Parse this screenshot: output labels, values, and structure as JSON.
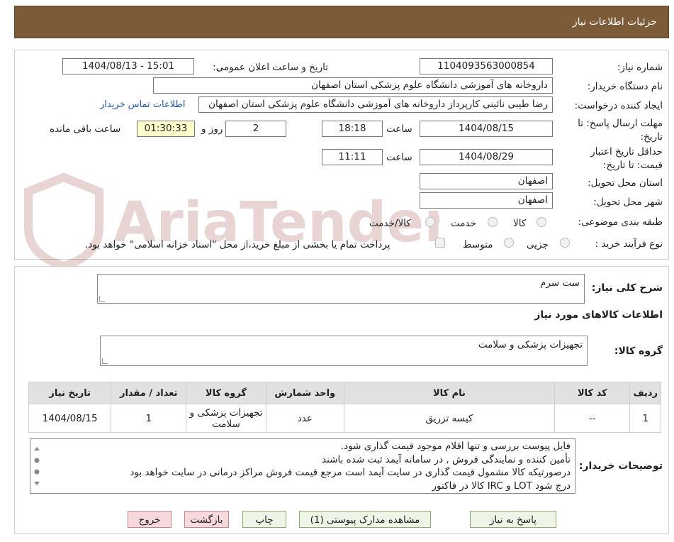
{
  "header": {
    "title": "جزئیات اطلاعات نیاز"
  },
  "form": {
    "need_number_label": "شماره نیاز:",
    "need_number": "1104093563000854",
    "announce_label": "تاریخ و ساعت اعلان عمومی:",
    "announce_value": "1404/08/13 - 15:01",
    "buyer_org_label": "نام دستگاه خریدار:",
    "buyer_org": "داروخانه های آموزشی دانشگاه علوم پزشکی استان اصفهان",
    "requester_label": "ایجاد کننده درخواست:",
    "requester": "رضا طیبی نائینی کارپرداز داروخانه های آموزشی دانشگاه علوم پزشکی استان اصفهان",
    "contact_link": "اطلاعات تماس خریدار",
    "deadline_label": "مهلت ارسال پاسخ: تا تاریخ:",
    "deadline_date": "1404/08/15",
    "time_label": "ساعت",
    "deadline_time": "18:18",
    "days_value": "2",
    "days_label": "روز و",
    "remaining_time": "01:30:33",
    "remaining_label": "ساعت باقی مانده",
    "validity_label": "حداقل تاریخ اعتبار قیمت: تا تاریخ:",
    "validity_date": "1404/08/29",
    "validity_time": "11:11",
    "province_label": "استان محل تحویل:",
    "province": "اصفهان",
    "city_label": "شهر محل تحویل:",
    "city": "اصفهان",
    "category_label": "طبقه بندی موضوعی:",
    "category_options": [
      "کالا",
      "خدمت",
      "کالا/خدمت"
    ],
    "process_label": "نوع فرآیند خرید :",
    "process_options": [
      "جزیی",
      "متوسط"
    ],
    "payment_note": "پرداخت تمام یا بخشی از مبلغ خرید،از محل \"اسناد خزانه اسلامی\" خواهد بود."
  },
  "summary": {
    "label": "شرح کلی نیاز:",
    "value": "ست سرم",
    "items_title": "اطلاعات کالاهای مورد نیاز",
    "group_label": "گروه کالا:",
    "group_value": "تجهیزات پزشکی و سلامت"
  },
  "table": {
    "headers": [
      "ردیف",
      "کد کالا",
      "نام کالا",
      "واحد شمارش",
      "گروه کالا",
      "تعداد / مقدار",
      "تاریخ نیاز"
    ],
    "rows": [
      [
        "1",
        "--",
        "کیسه تزریق",
        "عدد",
        "تجهیزات پزشکی و سلامت",
        "1",
        "1404/08/15"
      ]
    ]
  },
  "notes": {
    "label": "توضیحات خریدار:",
    "lines": [
      "فایل پیوست بررسی و تنها اقلام موجود قیمت گذاری شود.",
      "تأمین کننده و نمایندگی فروش , در سامانه آیمد ثبت شده باشند",
      "درصورتیکه کالا مشمول قیمت گذاری در سایت آیمد است مرجع قیمت فروش مراکز درمانی در سایت خواهد بود",
      "درج شود LOT و IRC کالا در فاکتور"
    ]
  },
  "buttons": {
    "reply": "پاسخ به نیاز",
    "attachments": "مشاهده مدارک پیوستی (1)",
    "print": "چاپ",
    "back": "بازگشت",
    "exit": "خروج"
  },
  "watermark": {
    "text": "AriaTender.neT"
  },
  "colors": {
    "header_bg": "#7b5b38",
    "link": "#2255aa",
    "highlight": "#ffffcc"
  }
}
